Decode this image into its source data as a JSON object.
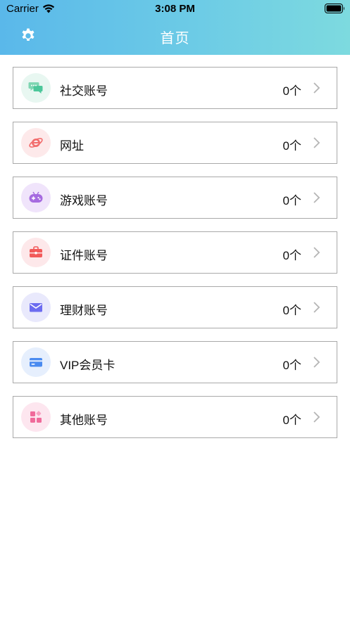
{
  "status_bar": {
    "carrier": "Carrier",
    "time": "3:08 PM"
  },
  "header": {
    "title": "首页",
    "settings_icon": "gear-icon"
  },
  "categories": [
    {
      "label": "社交账号",
      "count": "0个",
      "icon": "chat-bubbles-icon",
      "icon_color": "#4cc79a",
      "icon_bg": "#e8f7f1"
    },
    {
      "label": "网址",
      "count": "0个",
      "icon": "internet-explorer-icon",
      "icon_color": "#f26d6d",
      "icon_bg": "#fde9ea"
    },
    {
      "label": "游戏账号",
      "count": "0个",
      "icon": "game-controller-icon",
      "icon_color": "#a66be0",
      "icon_bg": "#f0e4fb"
    },
    {
      "label": "证件账号",
      "count": "0个",
      "icon": "briefcase-icon",
      "icon_color": "#f25a5a",
      "icon_bg": "#fde8ea"
    },
    {
      "label": "理财账号",
      "count": "0个",
      "icon": "envelope-icon",
      "icon_color": "#6c6cf0",
      "icon_bg": "#e9e9fc"
    },
    {
      "label": "VIP会员卡",
      "count": "0个",
      "icon": "credit-card-icon",
      "icon_color": "#4a8bf0",
      "icon_bg": "#e6effd"
    },
    {
      "label": "其他账号",
      "count": "0个",
      "icon": "apps-grid-icon",
      "icon_color": "#f06a9a",
      "icon_bg": "#fde6ef"
    }
  ]
}
